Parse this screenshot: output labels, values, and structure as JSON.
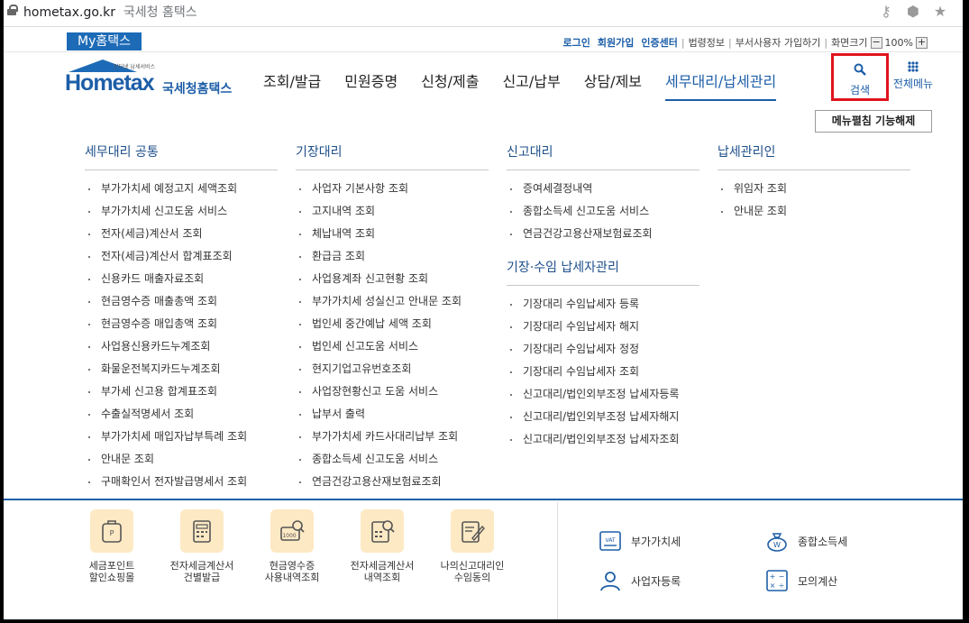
{
  "browser": {
    "url": "hometax.go.kr",
    "page_title": "국세청 홈택스"
  },
  "util_bar": {
    "my_home": "My홈택스",
    "login": "로그인",
    "join": "회원가입",
    "cert_center": "인증센터",
    "law_info": "법령정보",
    "dept_user": "부서사용자 가입하기",
    "screen_size": "화면크기",
    "zoom": "100%"
  },
  "header": {
    "logo_sub": "인터넷 납세서비스",
    "logo_text": "Hometax",
    "logo_name": "국세청홈택스",
    "nav": [
      "조회/발급",
      "민원증명",
      "신청/제출",
      "신고/납부",
      "상담/제보",
      "세무대리/납세관리"
    ],
    "search_label": "검색",
    "all_menu_label": "전체메뉴"
  },
  "panel": {
    "unfold_button": "메뉴펼침 기능해제",
    "col1": {
      "title": "세무대리 공통",
      "items": [
        "부가가치세 예정고지 세액조회",
        "부가가치세 신고도움 서비스",
        "전자(세금)계산서 조회",
        "전자(세금)계산서 합계표조회",
        "신용카드 매출자료조회",
        "현금영수증 매출총액 조회",
        "현금영수증 매입총액 조회",
        "사업용신용카드누계조회",
        "화물운전복지카드누계조회",
        "부가세 신고용 합계표조회",
        "수출실적명세서 조회",
        "부가가치세 매입자납부특례 조회",
        "안내문 조회",
        "구매확인서 전자발급명세서 조회"
      ]
    },
    "col2": {
      "title": "기장대리",
      "items": [
        "사업자 기본사항 조회",
        "고지내역 조회",
        "체납내역 조회",
        "환급금 조회",
        "사업용계좌 신고현황 조회",
        "부가가치세 성실신고 안내문 조회",
        "법인세 중간예납 세액 조회",
        "법인세 신고도움 서비스",
        "현지기업고유번호조회",
        "사업장현황신고 도움 서비스",
        "납부서 출력",
        "부가가치세 카드사대리납부 조회",
        "종합소득세 신고도움 서비스",
        "연금건강고용산재보험료조회"
      ]
    },
    "col3": {
      "title": "신고대리",
      "items": [
        "증여세결정내역",
        "종합소득세 신고도움 서비스",
        "연금건강고용산재보험료조회"
      ],
      "title2": "기장·수임 납세자관리",
      "items2": [
        "기장대리 수임납세자 등록",
        "기장대리 수임납세자 해지",
        "기장대리 수임납세자 정정",
        "기장대리 수임납세자 조회",
        "신고대리/법인외부조정 납세자등록",
        "신고대리/법인외부조정 납세자해지",
        "신고대리/법인외부조정 납세자조회"
      ]
    },
    "col4": {
      "title": "납세관리인",
      "items": [
        "위임자 조회",
        "안내문 조회"
      ]
    }
  },
  "bottom": {
    "quick": [
      {
        "l1": "세금포인트",
        "l2": "할인쇼핑몰",
        "icon": "tax-bag-icon"
      },
      {
        "l1": "전자세금계산서",
        "l2": "건별발급",
        "icon": "calculator-doc-icon"
      },
      {
        "l1": "현금영수증",
        "l2": "사용내역조회",
        "icon": "receipt-search-icon"
      },
      {
        "l1": "전자세금계산서",
        "l2": "내역조회",
        "icon": "invoice-search-icon"
      },
      {
        "l1": "나의신고대리인",
        "l2": "수임동의",
        "icon": "sign-doc-icon"
      }
    ],
    "services": [
      "부가가치세",
      "종합소득세",
      "사업자등록",
      "모의계산"
    ]
  },
  "colors": {
    "brand": "#1d5ea8",
    "highlight": "#e0141e",
    "quick_bg": "#fde9c4"
  }
}
